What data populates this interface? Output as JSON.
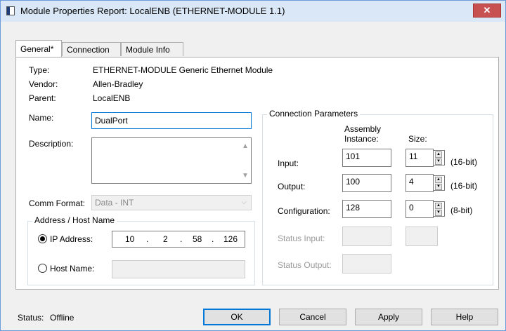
{
  "window": {
    "title": "Module Properties Report: LocalENB (ETHERNET-MODULE 1.1)",
    "close_glyph": "✕",
    "accent_color": "#0078d7"
  },
  "tabs": [
    {
      "label": "General*",
      "active": true
    },
    {
      "label": "Connection",
      "active": false
    },
    {
      "label": "Module Info",
      "active": false
    }
  ],
  "general": {
    "type_label": "Type:",
    "type_value": "ETHERNET-MODULE Generic Ethernet Module",
    "vendor_label": "Vendor:",
    "vendor_value": "Allen-Bradley",
    "parent_label": "Parent:",
    "parent_value": "LocalENB",
    "name_label": "Name:",
    "name_value": "DualPort",
    "description_label": "Description:",
    "description_value": "",
    "comm_format_label": "Comm Format:",
    "comm_format_value": "Data - INT"
  },
  "address": {
    "group_title": "Address / Host Name",
    "ip_label": "IP Address:",
    "ip_octets": [
      "10",
      ".",
      "2",
      ".",
      "58",
      ".",
      "126"
    ],
    "ip_selected": true,
    "host_label": "Host Name:",
    "host_value": ""
  },
  "connection": {
    "group_title": "Connection Parameters",
    "assembly_header_1": "Assembly",
    "assembly_header_2": "Instance:",
    "size_header": "Size:",
    "input_label": "Input:",
    "input_instance": "101",
    "input_size": "11",
    "input_unit": "(16-bit)",
    "output_label": "Output:",
    "output_instance": "100",
    "output_size": "4",
    "output_unit": "(16-bit)",
    "config_label": "Configuration:",
    "config_instance": "128",
    "config_size": "0",
    "config_unit": "(8-bit)",
    "status_input_label": "Status Input:",
    "status_output_label": "Status Output:"
  },
  "footer": {
    "status_label": "Status:",
    "status_value": "Offline",
    "ok_label": "OK",
    "cancel_label": "Cancel",
    "apply_label": "Apply",
    "help_label": "Help"
  }
}
